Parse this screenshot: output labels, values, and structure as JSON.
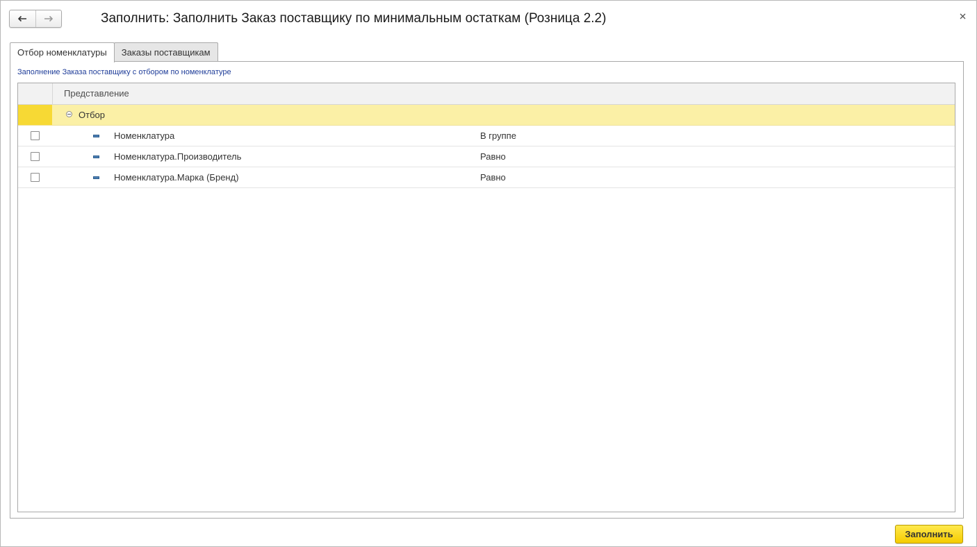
{
  "window": {
    "title": "Заполнить: Заполнить Заказ поставщику по минимальным остаткам (Розница 2.2)"
  },
  "tabs": [
    {
      "label": "Отбор номенклатуры",
      "active": true
    },
    {
      "label": "Заказы поставщикам",
      "active": false
    }
  ],
  "panel": {
    "caption": "Заполнение Заказа поставщику с отбором по номенклатуре",
    "table": {
      "header": "Представление",
      "group": {
        "label": "Отбор"
      },
      "rows": [
        {
          "field": "Номенклатура",
          "condition": "В группе",
          "checked": false
        },
        {
          "field": "Номенклатура.Производитель",
          "condition": "Равно",
          "checked": false
        },
        {
          "field": "Номенклатура.Марка (Бренд)",
          "condition": "Равно",
          "checked": false
        }
      ]
    }
  },
  "footer": {
    "fill_label": "Заполнить"
  },
  "colors": {
    "accent_yellow": "#f7d934",
    "group_row": "#fbf0a6",
    "caption_blue": "#1f3d99"
  }
}
